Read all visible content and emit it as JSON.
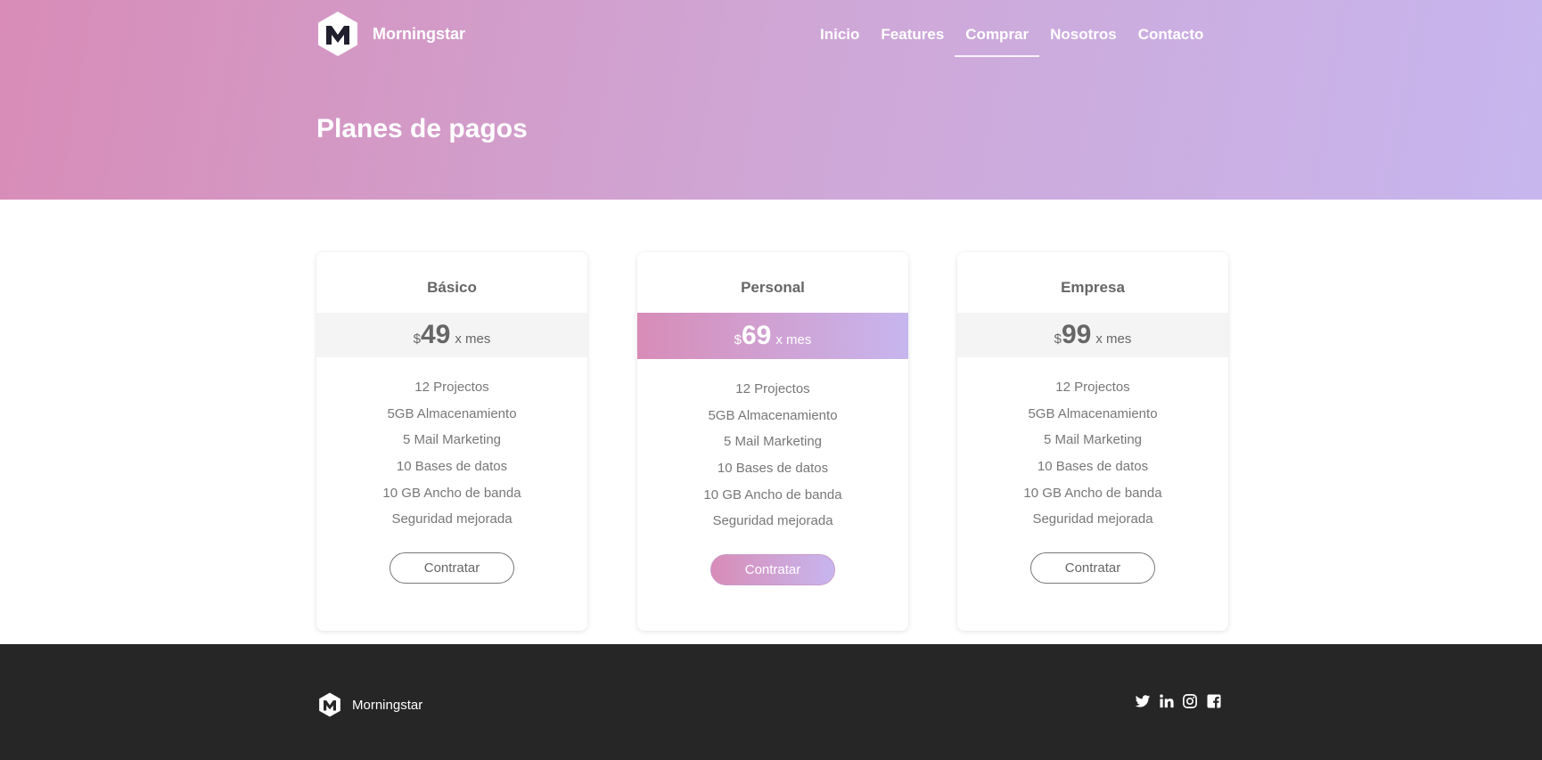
{
  "brand": {
    "name": "Morningstar"
  },
  "nav": [
    {
      "label": "Inicio"
    },
    {
      "label": "Features"
    },
    {
      "label": "Comprar",
      "active": true
    },
    {
      "label": "Nosotros"
    },
    {
      "label": "Contacto"
    }
  ],
  "hero": {
    "title": "Planes de pagos"
  },
  "plans": [
    {
      "name": "Básico",
      "currency": "$",
      "amount": "49",
      "period": "x mes",
      "features": [
        "12 Projectos",
        "5GB Almacenamiento",
        "5 Mail Marketing",
        "10 Bases de datos",
        "10 GB Ancho de banda",
        "Seguridad mejorada"
      ],
      "cta": "Contratar"
    },
    {
      "name": "Personal",
      "currency": "$",
      "amount": "69",
      "period": "x mes",
      "featured": true,
      "features": [
        "12 Projectos",
        "5GB Almacenamiento",
        "5 Mail Marketing",
        "10 Bases de datos",
        "10 GB Ancho de banda",
        "Seguridad mejorada"
      ],
      "cta": "Contratar"
    },
    {
      "name": "Empresa",
      "currency": "$",
      "amount": "99",
      "period": "x mes",
      "features": [
        "12 Projectos",
        "5GB Almacenamiento",
        "5 Mail Marketing",
        "10 Bases de datos",
        "10 GB Ancho de banda",
        "Seguridad mejorada"
      ],
      "cta": "Contratar"
    }
  ],
  "footer": {
    "brand": "Morningstar",
    "social": [
      "twitter-icon",
      "linkedin-icon",
      "instagram-icon",
      "facebook-icon"
    ]
  },
  "colors": {
    "gradient_start": "#d88cb7",
    "gradient_end": "#c7b6ee",
    "footer_bg": "#262626"
  }
}
